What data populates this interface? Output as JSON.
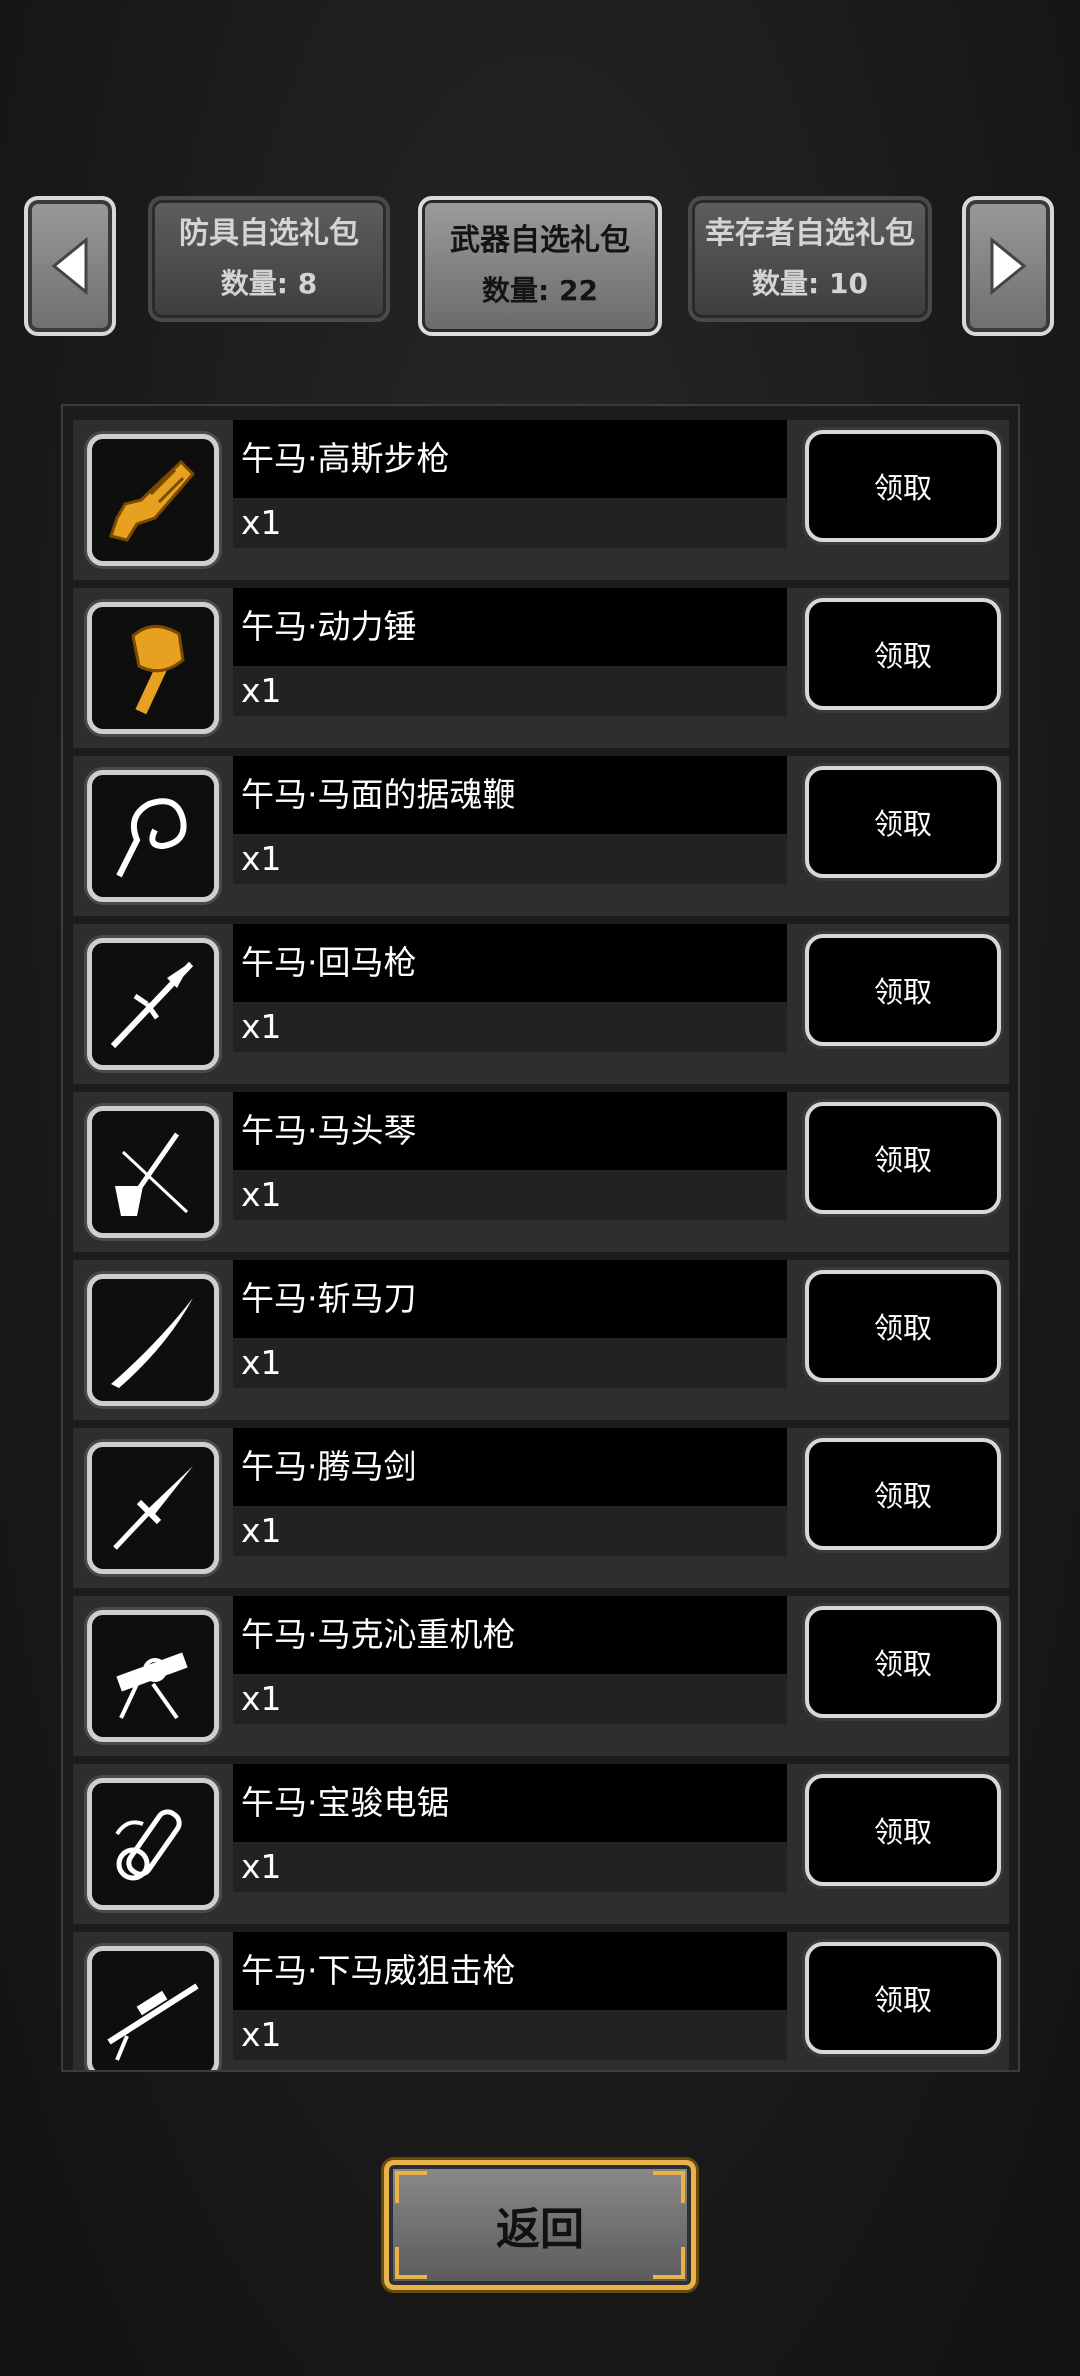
{
  "tabs": [
    {
      "title": "防具自选礼包",
      "count": "数量: 8",
      "active": false
    },
    {
      "title": "武器自选礼包",
      "count": "数量: 22",
      "active": true
    },
    {
      "title": "幸存者自选礼包",
      "count": "数量: 10",
      "active": false
    }
  ],
  "items": [
    {
      "name": "午马·高斯步枪",
      "qty": "x1",
      "button": "领取",
      "icon": "gauss-rifle-icon"
    },
    {
      "name": "午马·动力锤",
      "qty": "x1",
      "button": "领取",
      "icon": "power-hammer-icon"
    },
    {
      "name": "午马·马面的据魂鞭",
      "qty": "x1",
      "button": "领取",
      "icon": "soul-whip-icon"
    },
    {
      "name": "午马·回马枪",
      "qty": "x1",
      "button": "领取",
      "icon": "spear-icon"
    },
    {
      "name": "午马·马头琴",
      "qty": "x1",
      "button": "领取",
      "icon": "horsehead-fiddle-icon"
    },
    {
      "name": "午马·斩马刀",
      "qty": "x1",
      "button": "领取",
      "icon": "saber-icon"
    },
    {
      "name": "午马·腾马剑",
      "qty": "x1",
      "button": "领取",
      "icon": "sword-icon"
    },
    {
      "name": "午马·马克沁重机枪",
      "qty": "x1",
      "button": "领取",
      "icon": "machine-gun-icon"
    },
    {
      "name": "午马·宝骏电锯",
      "qty": "x1",
      "button": "领取",
      "icon": "chainsaw-icon"
    },
    {
      "name": "午马·下马威狙击枪",
      "qty": "x1",
      "button": "领取",
      "icon": "sniper-rifle-icon"
    }
  ],
  "back_label": "返回",
  "colors": {
    "gold_icon": "#e8a020",
    "frame": "#cfcfcf",
    "back_border": "#e7b34a"
  }
}
